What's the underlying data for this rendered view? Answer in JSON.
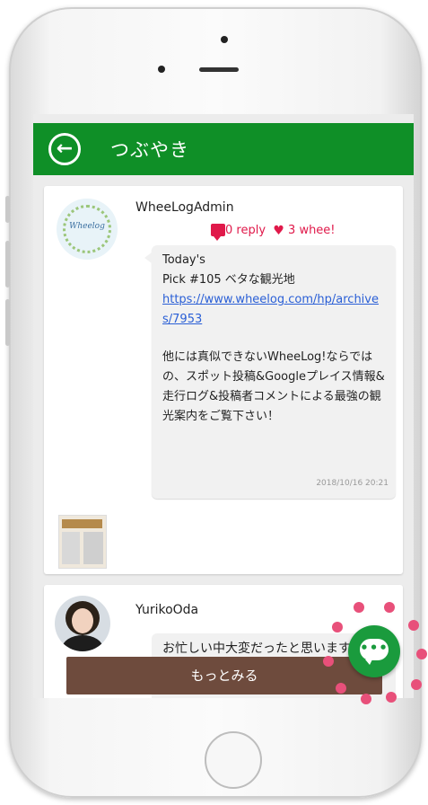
{
  "appbar": {
    "title": "つぶやき"
  },
  "posts": [
    {
      "username": "WheeLogAdmin",
      "avatar_text": "Wheelog",
      "reply_count": "0",
      "reply_label": "reply",
      "whee_count": "3",
      "whee_label": "whee!",
      "line1": "Today's",
      "line2": "Pick #105 ベタな観光地",
      "link": "https://www.wheelog.com/hp/archives/7953",
      "body": "他には真似できないWheeLog!ならではの、スポット投稿&Googleプレイス情報&走行ログ&投稿者コメントによる最強の観光案内をご覧下さい！",
      "timestamp": "2018/10/16 20:21"
    },
    {
      "username": "YurikoOda",
      "text": "お忙しい中大変だったと思います。盛り上げていただきありがとうございました"
    }
  ],
  "more_button": {
    "label": "もっとみる"
  },
  "fab": {
    "icon": "chat-bubble-icon",
    "color": "#1a9b3d"
  },
  "colors": {
    "appbar": "#0f8f27",
    "accent": "#e0194a",
    "button": "#6e4b3d",
    "link": "#2a5fd6"
  }
}
